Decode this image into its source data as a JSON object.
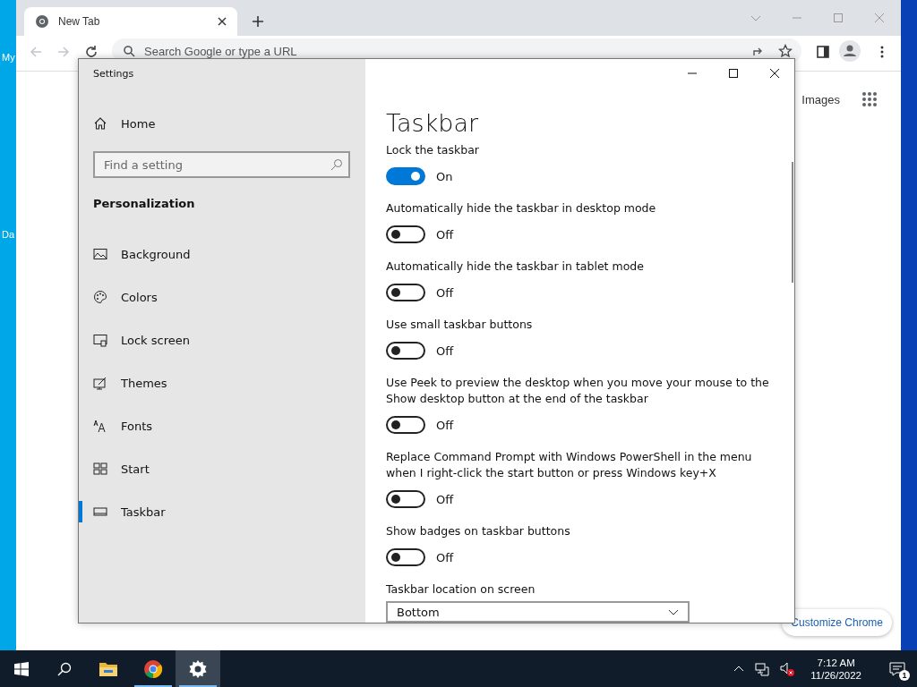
{
  "desktop": {
    "icon_labels": [
      "My",
      "Da"
    ]
  },
  "browser": {
    "tabs": [
      {
        "title": "New Tab",
        "selected": true
      }
    ],
    "nav_buttons": [
      {
        "kind": "back",
        "disabled": true
      },
      {
        "kind": "forward",
        "disabled": true
      },
      {
        "kind": "reload",
        "disabled": false
      }
    ],
    "omnibox": {
      "placeholder": "Search Google or type a URL"
    },
    "page": {
      "link": "Images",
      "customize_button": "Customize Chrome"
    }
  },
  "settings": {
    "window": {
      "title": "Settings"
    },
    "home": "Home",
    "search": {
      "placeholder": "Find a setting"
    },
    "section": "Personalization",
    "nav": [
      {
        "label": "Background",
        "kind": "background",
        "selected": false
      },
      {
        "label": "Colors",
        "kind": "colors",
        "selected": false
      },
      {
        "label": "Lock screen",
        "kind": "lock",
        "selected": false
      },
      {
        "label": "Themes",
        "kind": "themes",
        "selected": false
      },
      {
        "label": "Fonts",
        "kind": "fonts",
        "selected": false
      },
      {
        "label": "Start",
        "kind": "start",
        "selected": false
      },
      {
        "label": "Taskbar",
        "kind": "taskbar",
        "selected": true
      }
    ],
    "heading": "Taskbar",
    "toggles": [
      {
        "label": "Lock the taskbar",
        "on": true,
        "state_text": "On"
      },
      {
        "label": "Automatically hide the taskbar in desktop mode",
        "on": false,
        "state_text": "Off"
      },
      {
        "label": "Automatically hide the taskbar in tablet mode",
        "on": false,
        "state_text": "Off"
      },
      {
        "label": "Use small taskbar buttons",
        "on": false,
        "state_text": "Off"
      },
      {
        "label": "Use Peek to preview the desktop when you move your mouse to the Show desktop button at the end of the taskbar",
        "on": false,
        "state_text": "Off"
      },
      {
        "label": "Replace Command Prompt with Windows PowerShell in the menu when I right-click the start button or press Windows key+X",
        "on": false,
        "state_text": "Off"
      },
      {
        "label": "Show badges on taskbar buttons",
        "on": false,
        "state_text": "Off"
      }
    ],
    "location": {
      "label": "Taskbar location on screen",
      "value": "Bottom"
    }
  },
  "taskbar": {
    "apps": [
      {
        "kind": "explorer",
        "running": false,
        "selected": false
      },
      {
        "kind": "chrome",
        "running": true,
        "selected": false
      },
      {
        "kind": "settings",
        "running": true,
        "selected": true
      }
    ],
    "volume_muted": true,
    "clock": {
      "time": "7:12 AM",
      "date": "11/26/2022"
    },
    "notifications": {
      "count": "1"
    }
  }
}
